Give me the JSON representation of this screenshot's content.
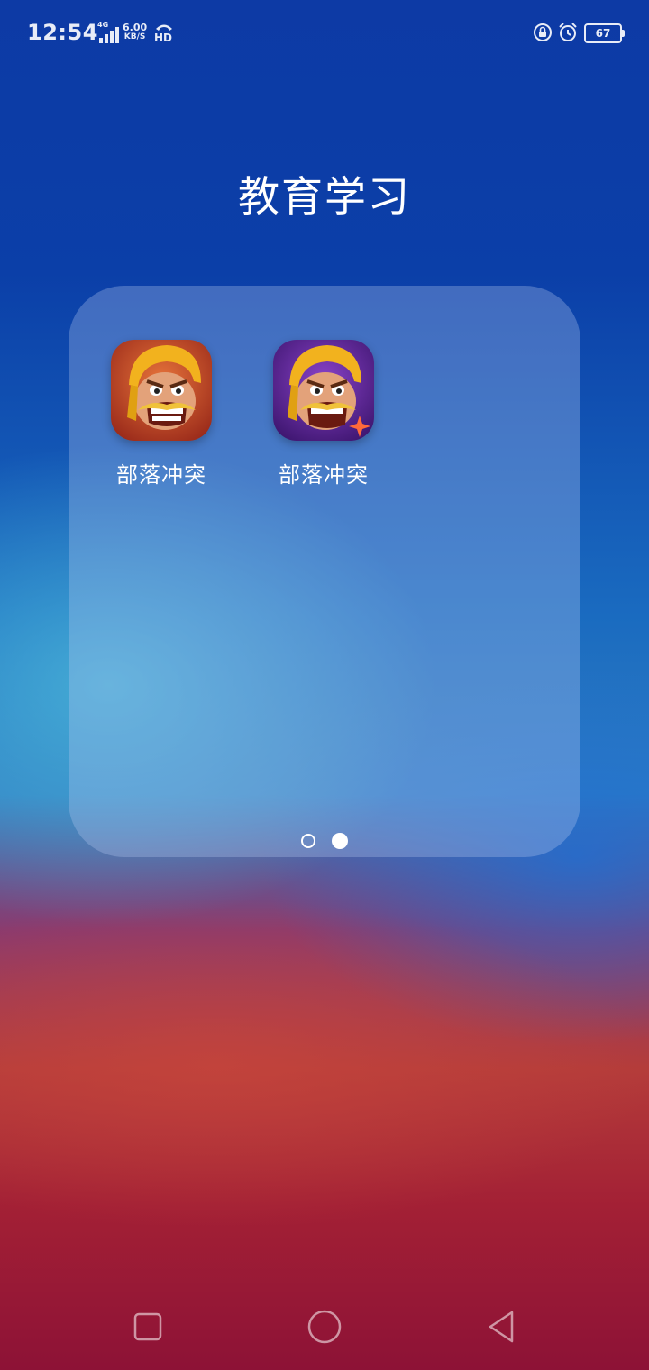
{
  "status_bar": {
    "time": "12:54",
    "network": "4G",
    "speed_value": "6.00",
    "speed_unit": "KB/S",
    "hd": "HD",
    "battery": "67",
    "icons": [
      "signal-icon",
      "call-hd-icon",
      "rotation-lock-icon",
      "alarm-icon",
      "battery-icon"
    ]
  },
  "folder": {
    "title": "教育学习",
    "apps": [
      {
        "label": "部落冲突",
        "icon": "clash-of-clans-icon"
      },
      {
        "label": "部落冲突",
        "icon": "clash-of-clans-variant-icon"
      }
    ],
    "pages": {
      "total": 2,
      "current": 2
    }
  },
  "nav_bar": {
    "icons": [
      "recent-apps-icon",
      "home-icon",
      "back-icon"
    ]
  },
  "colors": {
    "text": "#ffffff",
    "status_text": "#e8ecf7",
    "icon1_bg": "#c4482a",
    "icon2_bg": "#6a2aa8",
    "helmet": "#f2b21e"
  }
}
